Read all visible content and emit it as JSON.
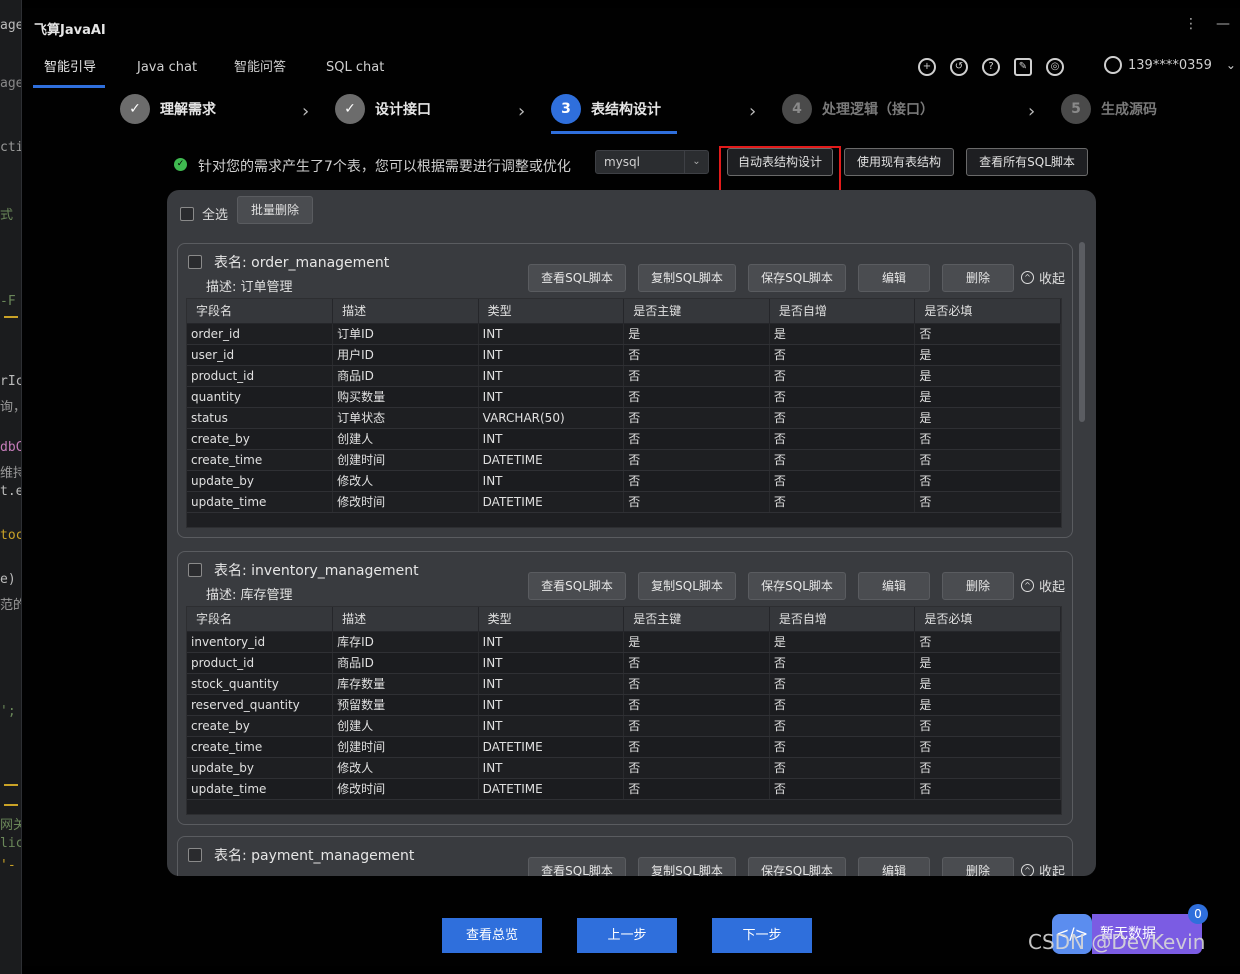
{
  "ide_fragments": [
    "age",
    "cti",
    "式",
    "-F",
    "rIc",
    "询，",
    "dbC",
    "维持",
    "t.e",
    "toc",
    "e)",
    "范的",
    "';",
    "网关",
    "lic",
    "'-"
  ],
  "app": {
    "title": "飞算JavaAI",
    "menu_icon": "more-vertical-icon",
    "minimize_icon": "minimize-icon"
  },
  "tabs": [
    {
      "label": "智能引导",
      "active": true
    },
    {
      "label": "Java chat",
      "active": false
    },
    {
      "label": "智能问答",
      "active": false
    },
    {
      "label": "SQL chat",
      "active": false
    }
  ],
  "tools": [
    "add-icon",
    "history-icon",
    "help-icon",
    "edit-icon",
    "settings-icon"
  ],
  "user": {
    "name": "139****0359"
  },
  "steps": [
    {
      "number": "✓",
      "label": "理解需求",
      "state": "done"
    },
    {
      "number": "✓",
      "label": "设计接口",
      "state": "done"
    },
    {
      "number": "3",
      "label": "表结构设计",
      "state": "current"
    },
    {
      "number": "4",
      "label": "处理逻辑（接口）",
      "state": "future"
    },
    {
      "number": "5",
      "label": "生成源码",
      "state": "future"
    }
  ],
  "info": {
    "message": "针对您的需求产生了7个表，您可以根据需要进行调整或优化",
    "db_type": "mysql",
    "btn_auto": "自动表结构设计",
    "btn_existing": "使用现有表结构",
    "btn_all_sql": "查看所有SQL脚本"
  },
  "card": {
    "select_all": "全选",
    "batch_delete": "批量删除"
  },
  "actions": {
    "view_sql": "查看SQL脚本",
    "copy_sql": "复制SQL脚本",
    "save_sql": "保存SQL脚本",
    "edit": "编辑",
    "delete": "删除",
    "collapse": "收起"
  },
  "columns": [
    "字段名",
    "描述",
    "类型",
    "是否主键",
    "是否自增",
    "是否必填"
  ],
  "tables": [
    {
      "name_label": "表名: order_management",
      "desc_label": "描述: 订单管理",
      "rows": [
        [
          "order_id",
          "订单ID",
          "INT",
          "是",
          "是",
          "否"
        ],
        [
          "user_id",
          "用户ID",
          "INT",
          "否",
          "否",
          "是"
        ],
        [
          "product_id",
          "商品ID",
          "INT",
          "否",
          "否",
          "是"
        ],
        [
          "quantity",
          "购买数量",
          "INT",
          "否",
          "否",
          "是"
        ],
        [
          "status",
          "订单状态",
          "VARCHAR(50)",
          "否",
          "否",
          "是"
        ],
        [
          "create_by",
          "创建人",
          "INT",
          "否",
          "否",
          "否"
        ],
        [
          "create_time",
          "创建时间",
          "DATETIME",
          "否",
          "否",
          "否"
        ],
        [
          "update_by",
          "修改人",
          "INT",
          "否",
          "否",
          "否"
        ],
        [
          "update_time",
          "修改时间",
          "DATETIME",
          "否",
          "否",
          "否"
        ]
      ]
    },
    {
      "name_label": "表名: inventory_management",
      "desc_label": "描述: 库存管理",
      "rows": [
        [
          "inventory_id",
          "库存ID",
          "INT",
          "是",
          "是",
          "否"
        ],
        [
          "product_id",
          "商品ID",
          "INT",
          "否",
          "否",
          "是"
        ],
        [
          "stock_quantity",
          "库存数量",
          "INT",
          "否",
          "否",
          "是"
        ],
        [
          "reserved_quantity",
          "预留数量",
          "INT",
          "否",
          "否",
          "是"
        ],
        [
          "create_by",
          "创建人",
          "INT",
          "否",
          "否",
          "否"
        ],
        [
          "create_time",
          "创建时间",
          "DATETIME",
          "否",
          "否",
          "否"
        ],
        [
          "update_by",
          "修改人",
          "INT",
          "否",
          "否",
          "否"
        ],
        [
          "update_time",
          "修改时间",
          "DATETIME",
          "否",
          "否",
          "否"
        ]
      ]
    },
    {
      "name_label": "表名: payment_management",
      "desc_label": "",
      "rows": []
    }
  ],
  "bottom": {
    "overview": "查看总览",
    "prev": "上一步",
    "next": "下一步"
  },
  "floating": {
    "label": "暂无数据",
    "badge": "0"
  },
  "watermark": "CSDN @DevKevin",
  "colors": {
    "accent": "#2f6fdc",
    "highlight": "#e21b1b",
    "success": "#3fb950",
    "float_purple": "#7b5ce3"
  }
}
